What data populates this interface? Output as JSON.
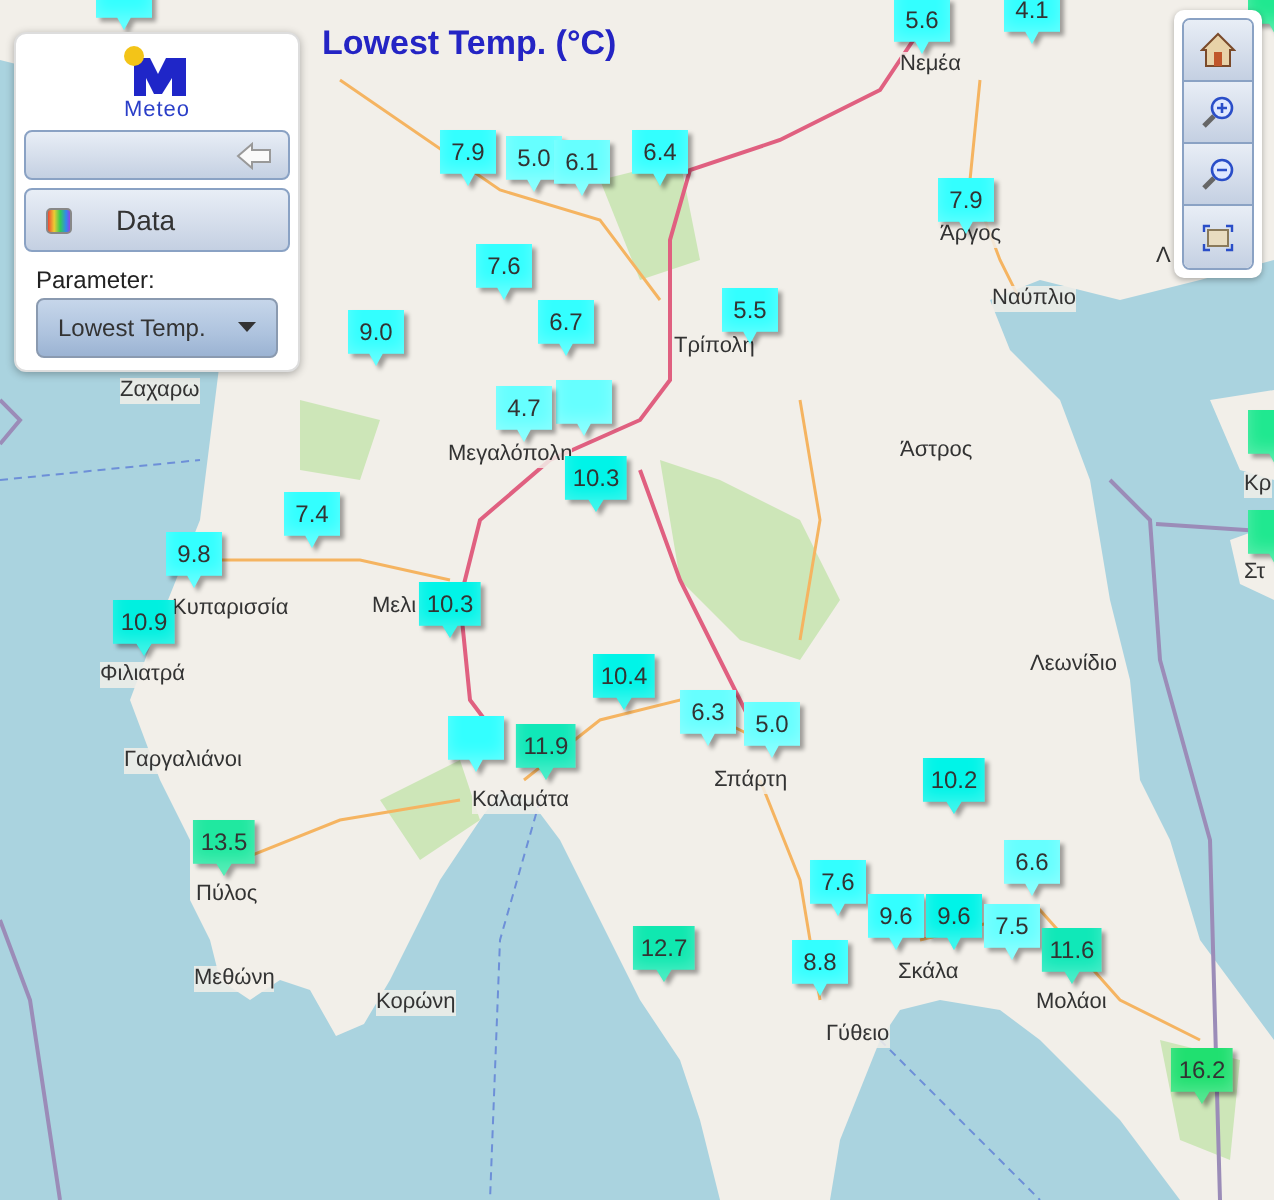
{
  "header": {
    "logo_text": "Meteo",
    "title": "Lowest Temp. (°C)"
  },
  "panel": {
    "data_button": "Data",
    "parameter_label": "Parameter:",
    "parameter_value": "Lowest Temp."
  },
  "places": [
    {
      "name": "Νεμέα"
    },
    {
      "name": "Άργος"
    },
    {
      "name": "Ναύπλιο"
    },
    {
      "name": "Τρίπολη"
    },
    {
      "name": "Ζαχαρω"
    },
    {
      "name": "Μεγαλόπολη"
    },
    {
      "name": "Κυπαρισσία"
    },
    {
      "name": "Μελι"
    },
    {
      "name": "Φιλιατρά"
    },
    {
      "name": "Γαργαλιάνοι"
    },
    {
      "name": "Καλαμάτα"
    },
    {
      "name": "Σπάρτη"
    },
    {
      "name": "Πύλος"
    },
    {
      "name": "Μεθώνη"
    },
    {
      "name": "Κορώνη"
    },
    {
      "name": "Γύθειο"
    },
    {
      "name": "Σκάλα"
    },
    {
      "name": "Μολάοι"
    },
    {
      "name": "Άστρος"
    },
    {
      "name": "Λεωνίδιο"
    },
    {
      "name": "Λ"
    },
    {
      "name": "Κρ"
    },
    {
      "name": "Στ"
    }
  ],
  "markers": [
    {
      "color": "#33ffff"
    },
    {
      "value": "5.6",
      "color": "#33ffff"
    },
    {
      "value": "4.1",
      "color": "#33ffff"
    },
    {
      "color": "#20e890"
    },
    {
      "value": "7.9",
      "color": "#33ffff"
    },
    {
      "value": "5.0",
      "color": "#66ffff"
    },
    {
      "value": "6.1",
      "color": "#66ffff"
    },
    {
      "value": "6.4",
      "color": "#33ffff"
    },
    {
      "value": "7.9",
      "color": "#33ffff"
    },
    {
      "value": "7.6",
      "color": "#33ffff"
    },
    {
      "value": "9.0",
      "color": "#33ffff"
    },
    {
      "value": "6.7",
      "color": "#33ffff"
    },
    {
      "value": "5.5",
      "color": "#33ffff"
    },
    {
      "color": "#66ffff"
    },
    {
      "value": "4.7",
      "color": "#66ffff"
    },
    {
      "value": "10.3",
      "color": "#00f4e8"
    },
    {
      "value": "7.4",
      "color": "#33ffff"
    },
    {
      "value": "9.8",
      "color": "#33ffff"
    },
    {
      "value": "10.9",
      "color": "#00f0e0"
    },
    {
      "value": "10.3",
      "color": "#00f4e8"
    },
    {
      "value": "10.4",
      "color": "#00f4e8"
    },
    {
      "value": "6.3",
      "color": "#66ffff"
    },
    {
      "value": "5.0",
      "color": "#66ffff"
    },
    {
      "color": "#33ffff"
    },
    {
      "value": "11.9",
      "color": "#10e8b8"
    },
    {
      "value": "10.2",
      "color": "#00f4e8"
    },
    {
      "value": "13.5",
      "color": "#20e8a0"
    },
    {
      "value": "7.6",
      "color": "#33ffff"
    },
    {
      "value": "6.6",
      "color": "#66ffff"
    },
    {
      "value": "9.6",
      "color": "#33ffff"
    },
    {
      "value": "9.6",
      "color": "#00f4e8"
    },
    {
      "value": "7.5",
      "color": "#66ffff"
    },
    {
      "value": "12.7",
      "color": "#10e8b0"
    },
    {
      "value": "8.8",
      "color": "#33ffff"
    },
    {
      "value": "11.6",
      "color": "#10e8b8"
    },
    {
      "value": "16.2",
      "color": "#20e070"
    },
    {
      "color": "#20e890"
    },
    {
      "color": "#20e890"
    }
  ]
}
